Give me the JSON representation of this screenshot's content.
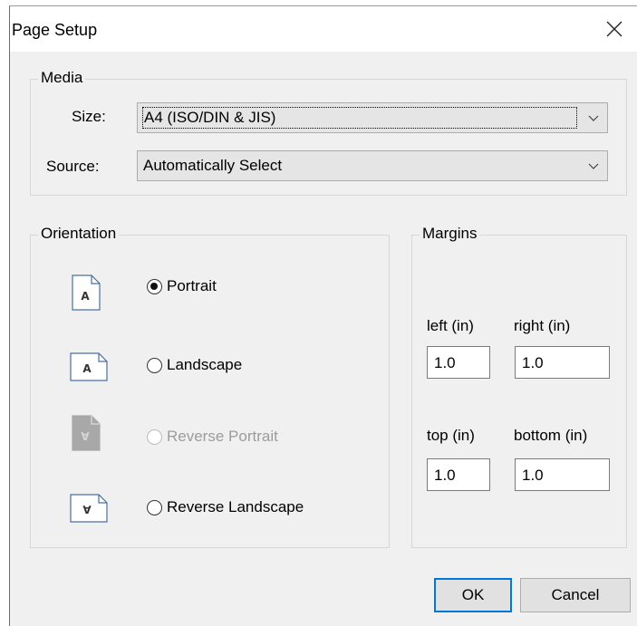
{
  "dialog": {
    "title": "Page Setup"
  },
  "media": {
    "legend": "Media",
    "size_label": "Size:",
    "size_value": "A4 (ISO/DIN & JIS)",
    "source_label": "Source:",
    "source_value": "Automatically Select"
  },
  "orientation": {
    "legend": "Orientation",
    "options": [
      {
        "label": "Portrait",
        "checked": true,
        "enabled": true,
        "icon_letter": "A"
      },
      {
        "label": "Landscape",
        "checked": false,
        "enabled": true,
        "icon_letter": "A"
      },
      {
        "label": "Reverse Portrait",
        "checked": false,
        "enabled": false,
        "icon_letter": "∀"
      },
      {
        "label": "Reverse Landscape",
        "checked": false,
        "enabled": true,
        "icon_letter": "∀"
      }
    ]
  },
  "margins": {
    "legend": "Margins",
    "left_label": "left (in)",
    "left_value": "1.0",
    "right_label": "right (in)",
    "right_value": "1.0",
    "top_label": "top (in)",
    "top_value": "1.0",
    "bottom_label": "bottom (in)",
    "bottom_value": "1.0"
  },
  "buttons": {
    "ok": "OK",
    "cancel": "Cancel"
  },
  "colors": {
    "default_button_border": "#0078d7",
    "dialog_bg": "#f0f0f0"
  }
}
